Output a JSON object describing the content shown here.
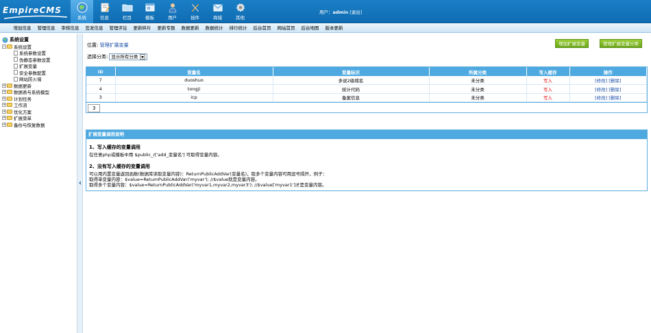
{
  "header": {
    "logo_text": "EmpireCMS",
    "nav": [
      {
        "label": "系统",
        "icon": "globe-icon",
        "active": true
      },
      {
        "label": "信息",
        "icon": "document-edit-icon",
        "active": false
      },
      {
        "label": "栏目",
        "icon": "folder-icon",
        "active": false
      },
      {
        "label": "模板",
        "icon": "template-window-icon",
        "active": false
      },
      {
        "label": "用户",
        "icon": "user-icon",
        "active": false
      },
      {
        "label": "插件",
        "icon": "tools-icon",
        "active": false
      },
      {
        "label": "商城",
        "icon": "shop-icon",
        "active": false
      },
      {
        "label": "其他",
        "icon": "gear-icon",
        "active": false
      }
    ],
    "user_prefix": "用户：",
    "username": "admin",
    "logout": "[退出]"
  },
  "submenu": [
    "增加信息",
    "管理信息",
    "审核信息",
    "签发信息",
    "管理评论",
    "更新碎片",
    "更新专题",
    "数据更新",
    "数据统计",
    "排行统计",
    "后台首页",
    "网站首页",
    "后台地图",
    "版本更新"
  ],
  "sidebar": {
    "root": "系统设置",
    "system": "系统设置",
    "system_children": [
      "系统参数设置",
      "伪静态参数设置",
      "扩展变量",
      "安全参数配置",
      "网站防火墙"
    ],
    "others": [
      "数据更新",
      "数据表与系统模型",
      "计划任务",
      "工作流",
      "优化方案",
      "扩展菜单",
      "备份与恢复数据"
    ]
  },
  "main": {
    "location_prefix": "位置: ",
    "location_link": "管理扩展变量",
    "btn_add": "增加扩展变量",
    "btn_class": "管理扩展变量分类",
    "filter_label": "选择分类:",
    "filter_value": "显示所有分类",
    "table": {
      "headers": [
        "ID",
        "变量名",
        "变量标识",
        "所属分类",
        "写入缓存",
        "操作"
      ],
      "rows": [
        {
          "id": "7",
          "name": "duoshuo",
          "mark": "多说2级域名",
          "cls": "未分类",
          "write": "写入",
          "edit": "[修改]",
          "del": "[删除]"
        },
        {
          "id": "4",
          "name": "tongji",
          "mark": "统计代码",
          "cls": "未分类",
          "write": "写入",
          "edit": "[修改]",
          "del": "[删除]"
        },
        {
          "id": "3",
          "name": "icp",
          "mark": "备案信息",
          "cls": "未分类",
          "write": "写入",
          "edit": "[修改]",
          "del": "[删除]"
        }
      ],
      "page": "3"
    },
    "help": {
      "title": "扩展变量调用说明",
      "h1": "1、写入缓存的变量调用",
      "p1": "在任意php或模板中用 $public_r['add_变量名'] 可取得变量内容。",
      "h2": "2、没有写入缓存的变量调用",
      "p2": "可以用内置变量返回函数(数据库读取变量内容)：ReturnPublicAddVar(变量名)，取多个变量内容可用逗号隔开，例子：",
      "p3": "取得单变量内容：$value=ReturnPublicAddVar('myvar'); //$value就是变量内容。",
      "p4": "取得多个变量内容：$value=ReturnPublicAddVar('myvar1,myvar2,myvar3'); //$value['myvar1']才是变量内容。"
    }
  }
}
